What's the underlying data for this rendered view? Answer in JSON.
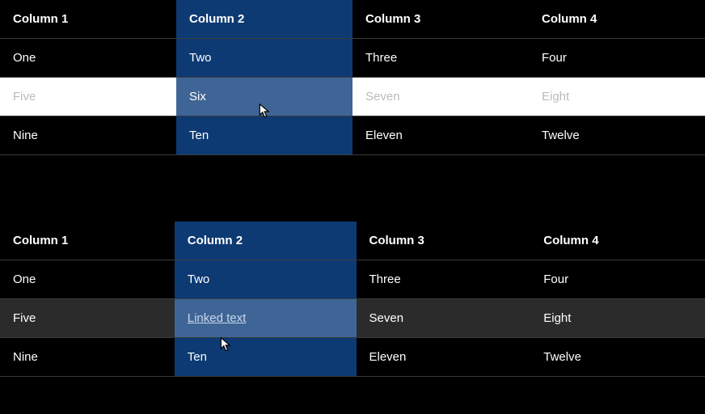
{
  "headers": [
    "Column 1",
    "Column 2",
    "Column 3",
    "Column 4"
  ],
  "top_table": {
    "rows": [
      [
        "One",
        "Two",
        "Three",
        "Four"
      ],
      [
        "Five",
        "Six",
        "Seven",
        "Eight"
      ],
      [
        "Nine",
        "Ten",
        "Eleven",
        "Twelve"
      ]
    ]
  },
  "bottom_table": {
    "rows": [
      [
        "One",
        "Two",
        "Three",
        "Four"
      ],
      [
        "Five",
        "Linked text",
        "Seven",
        "Eight"
      ],
      [
        "Nine",
        "Ten",
        "Eleven",
        "Twelve"
      ]
    ]
  },
  "highlighted_column_index": 1,
  "hovered_row_index": 1,
  "link_cell": {
    "table": "bottom",
    "row": 1,
    "col": 1
  }
}
